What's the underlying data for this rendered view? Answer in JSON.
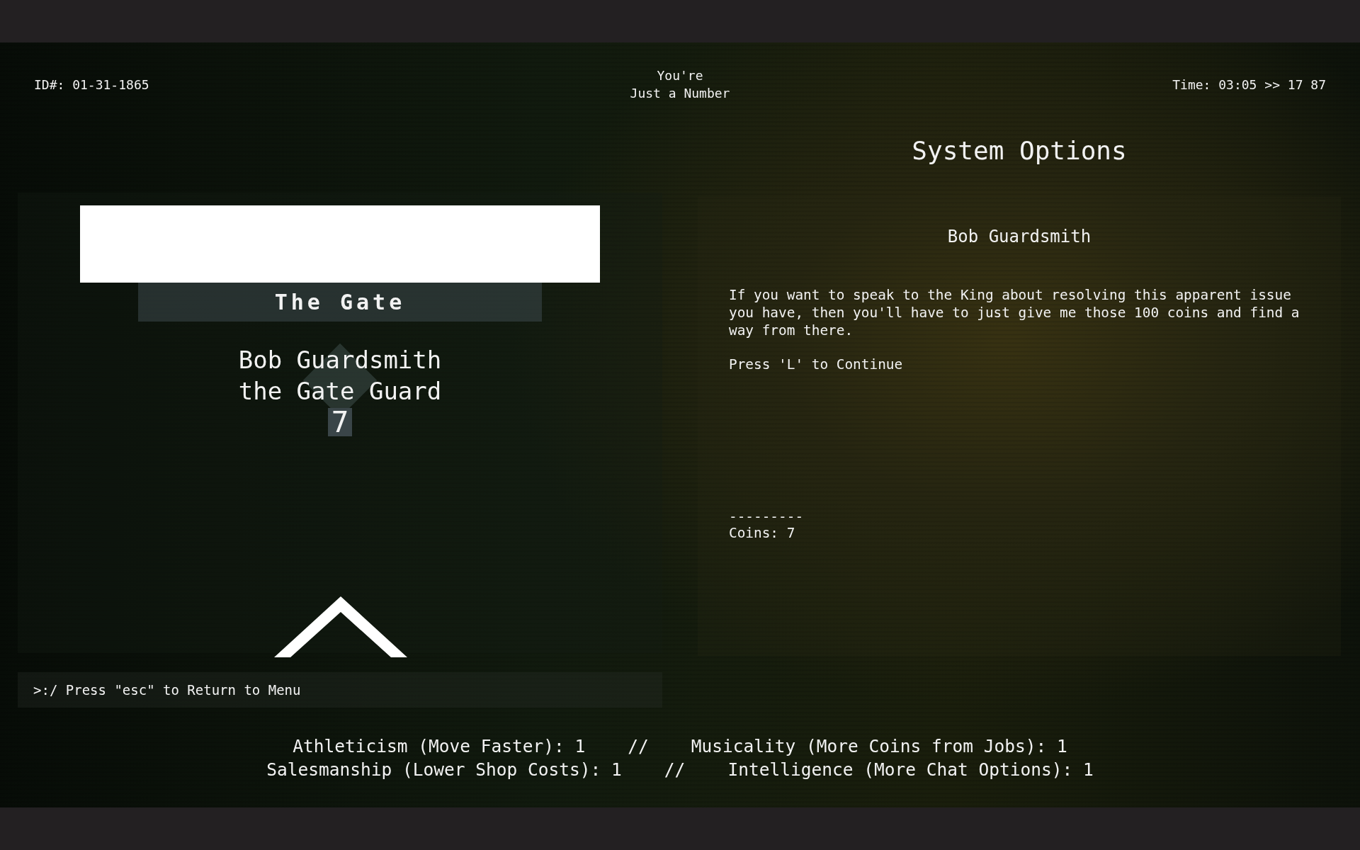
{
  "header": {
    "id": "ID#: 01-31-1865",
    "title_lines": [
      "You're",
      "Just a Number"
    ],
    "time": "Time: 03:05 >> 17 87"
  },
  "scene": {
    "location": "The Gate",
    "character_lines": [
      "Bob Guardsmith",
      "the Gate Guard"
    ],
    "count": "7"
  },
  "options": {
    "title": "System Options",
    "speaker": "Bob Guardsmith",
    "message": "If you want to speak to the King about resolving this apparent issue you have, then you'll have to just give me those 100 coins and find a way from there.",
    "prompt": "Press 'L' to Continue",
    "divider": "---------",
    "coins": "Coins: 7"
  },
  "command": ">:/ Press \"esc\" to Return to Menu",
  "stat_lines": [
    {
      "left": "Athleticism (Move Faster): 1",
      "separator": "//",
      "right": "Musicality (More Coins from Jobs): 1"
    },
    {
      "left": "Salesmanship (Lower Shop Costs): 1",
      "separator": "//",
      "right": "Intelligence (More Chat Options): 1"
    }
  ]
}
